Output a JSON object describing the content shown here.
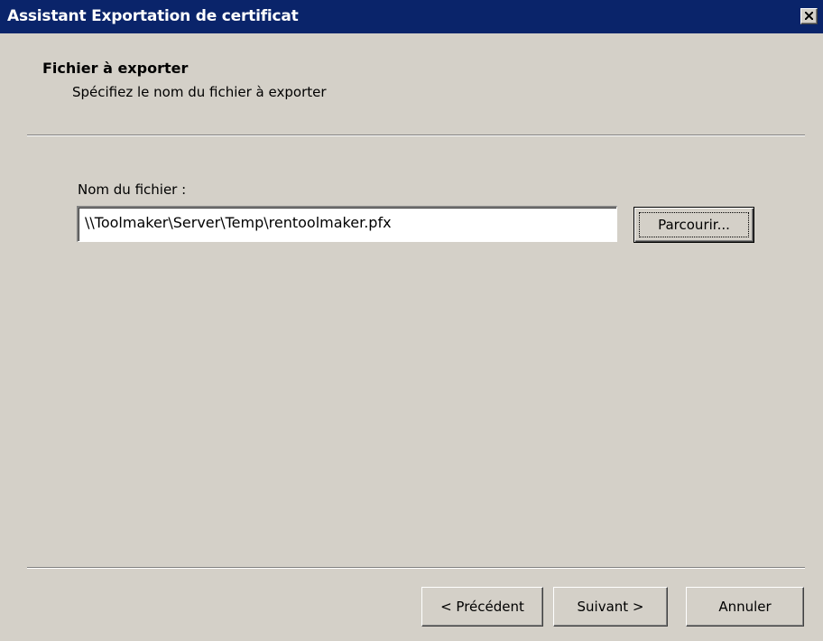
{
  "window": {
    "title": "Assistant Exportation de certificat",
    "close_icon": "close-x-icon"
  },
  "header": {
    "title": "Fichier à exporter",
    "subtitle": "Spécifiez le nom du fichier à exporter"
  },
  "form": {
    "file_label": "Nom du fichier :",
    "file_value": "\\\\Toolmaker\\Server\\Temp\\rentoolmaker.pfx",
    "browse_label": "Parcourir..."
  },
  "footer": {
    "back_label": "< Précédent",
    "next_label": "Suivant >",
    "cancel_label": "Annuler"
  }
}
